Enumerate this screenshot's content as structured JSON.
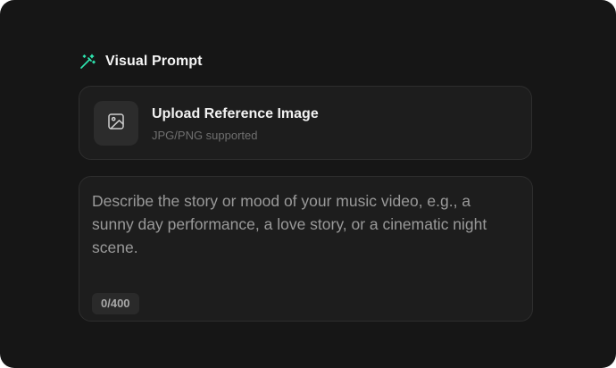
{
  "section": {
    "title": "Visual Prompt",
    "icon": "magic-wand-icon",
    "accent_color": "#2ee6b0"
  },
  "upload": {
    "title": "Upload Reference Image",
    "subtitle": "JPG/PNG supported",
    "icon": "image-icon"
  },
  "prompt": {
    "value": "",
    "placeholder": "Describe the story or mood of your music video, e.g., a sunny day performance, a love story, or a cinematic night scene.",
    "counter": "0/400"
  }
}
